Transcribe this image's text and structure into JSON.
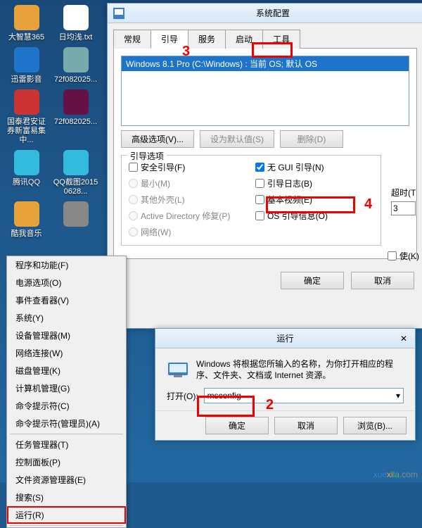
{
  "desktop_icons": [
    {
      "label": "大智慧365"
    },
    {
      "label": "日均浅.txt"
    },
    {
      "label": "迅雷影音"
    },
    {
      "label": "72f082025..."
    },
    {
      "label": "国泰君安证券新富易集中..."
    },
    {
      "label": "72f082025..."
    },
    {
      "label": "腾讯QQ"
    },
    {
      "label": "QQ截图20150628..."
    },
    {
      "label": "酷我音乐"
    },
    {
      "label": ""
    }
  ],
  "context_menu": {
    "items": [
      "程序和功能(F)",
      "电源选项(O)",
      "事件查看器(V)",
      "系统(Y)",
      "设备管理器(M)",
      "网络连接(W)",
      "磁盘管理(K)",
      "计算机管理(G)",
      "命令提示符(C)",
      "命令提示符(管理员)(A)",
      "-",
      "任务管理器(T)",
      "控制面板(P)",
      "文件资源管理器(E)",
      "搜索(S)",
      "运行(R)",
      "-"
    ],
    "highlight_index": 15
  },
  "msconfig": {
    "title": "系统配置",
    "tabs": [
      "常规",
      "引导",
      "服务",
      "启动",
      "工具"
    ],
    "active_tab": 1,
    "boot_entry": "Windows 8.1 Pro (C:\\Windows) : 当前 OS; 默认 OS",
    "buttons": {
      "adv": "高级选项(V)...",
      "setdef": "设为默认值(S)",
      "del": "删除(D)"
    },
    "boot_options_legend": "引导选项",
    "safe": "安全引导(F)",
    "nogui": "无 GUI 引导(N)",
    "min": "最小(M)",
    "bootlog": "引导日志(B)",
    "alt": "其他外壳(L)",
    "basevid": "基本视频(E)",
    "ad": "Active Directory 修复(P)",
    "osinfo": "OS 引导信息(O)",
    "net": "网络(W)",
    "timeout_label": "超时(T",
    "timeout_value": "3",
    "use_orig": "使(K)",
    "ok": "确定",
    "cancel": "取消"
  },
  "run": {
    "title": "运行",
    "desc": "Windows 将根据您所输入的名称，为你打开相应的程序、文件夹、文档或 Internet 资源。",
    "open_label": "打开(O):",
    "value": "msconfig",
    "ok": "确定",
    "cancel": "取消",
    "browse": "浏览(B)..."
  },
  "annotations": {
    "n2": "2",
    "n3": "3",
    "n4": "4"
  },
  "watermark": {
    "a": "xue",
    "b": "xi",
    "c": "la",
    "d": ".com"
  }
}
